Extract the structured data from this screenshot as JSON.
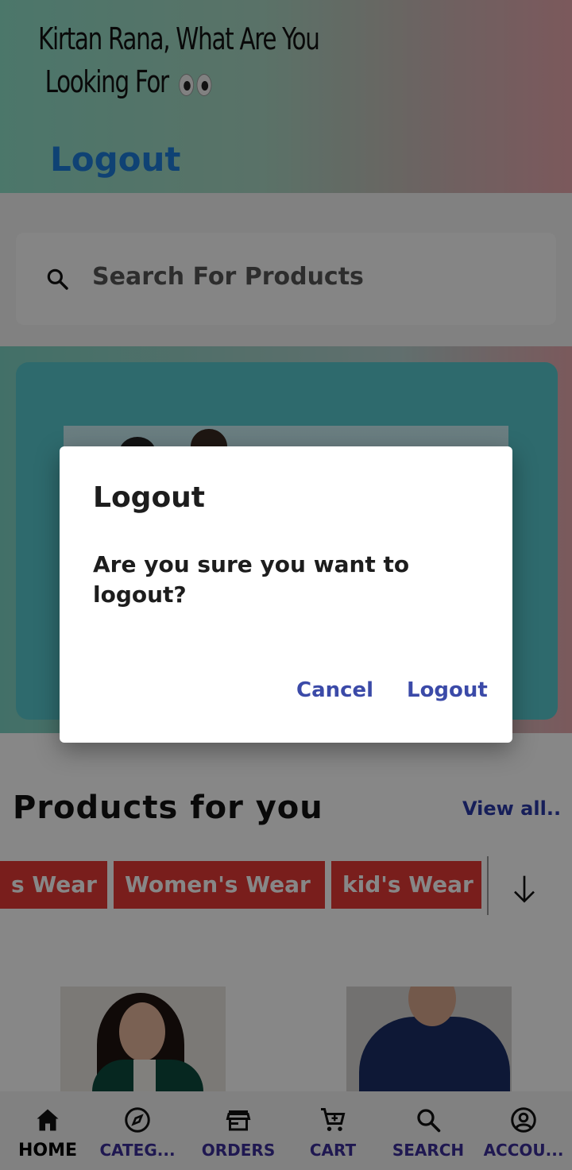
{
  "header": {
    "greeting_line1": "Kirtan  Rana, What Are You",
    "greeting_line2": "Looking For",
    "eyes_icon": "eyes-emoji",
    "logout_link": "Logout"
  },
  "search": {
    "placeholder": "Search For Products",
    "icon": "search-icon"
  },
  "products": {
    "title": "Products for you",
    "view_all": "View all..",
    "categories": [
      "s Wear",
      "Women's Wear",
      "kid's Wear"
    ],
    "more_icon": "arrow-down-icon"
  },
  "bottom_nav": {
    "items": [
      {
        "label": "HOME",
        "icon": "home-icon",
        "active": true
      },
      {
        "label": "CATEG...",
        "icon": "compass-icon",
        "active": false
      },
      {
        "label": "ORDERS",
        "icon": "store-icon",
        "active": false
      },
      {
        "label": "CART",
        "icon": "cart-icon",
        "active": false
      },
      {
        "label": "SEARCH",
        "icon": "search-icon",
        "active": false
      },
      {
        "label": "ACCOU...",
        "icon": "account-icon",
        "active": false
      }
    ]
  },
  "dialog": {
    "title": "Logout",
    "message": "Are you sure you want to logout?",
    "cancel": "Cancel",
    "confirm": "Logout"
  },
  "colors": {
    "accent": "#3b4aa8",
    "chip_red": "#e53935",
    "header_link": "#1e7ddb",
    "nav_label": "#3b2f9a"
  }
}
